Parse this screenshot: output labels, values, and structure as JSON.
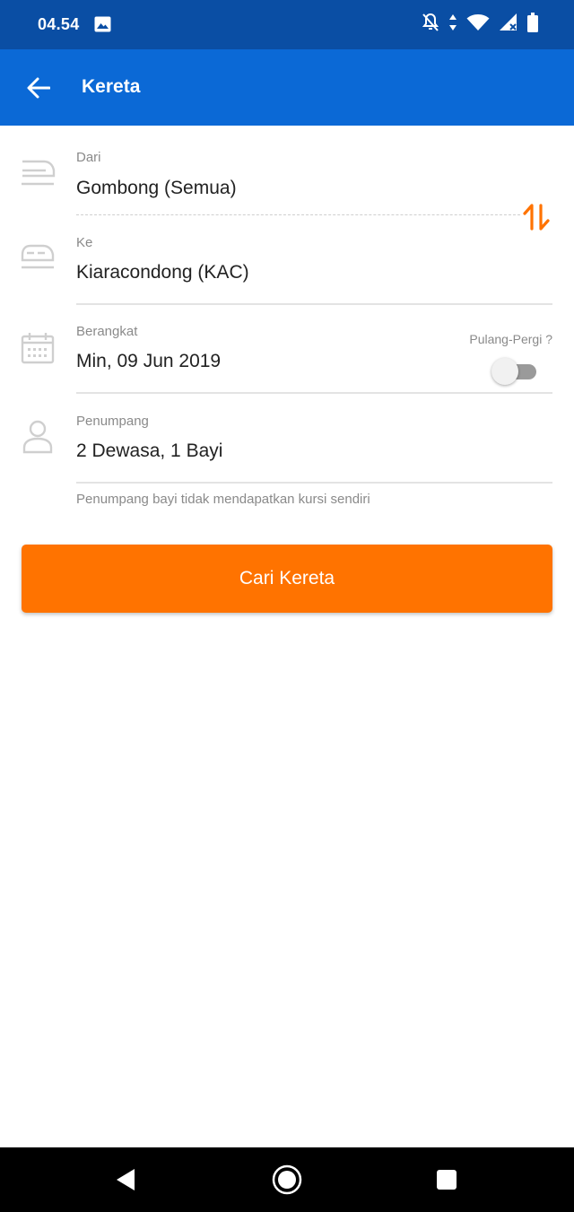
{
  "status_bar": {
    "time": "04.54"
  },
  "app_bar": {
    "title": "Kereta"
  },
  "form": {
    "from": {
      "label": "Dari",
      "value": "Gombong (Semua)"
    },
    "to": {
      "label": "Ke",
      "value": "Kiaracondong (KAC)"
    },
    "depart": {
      "label": "Berangkat",
      "value": "Min, 09 Jun 2019"
    },
    "round_trip": {
      "label": "Pulang-Pergi ?",
      "enabled": false
    },
    "passengers": {
      "label": "Penumpang",
      "value": "2 Dewasa, 1 Bayi"
    },
    "note": "Penumpang bayi tidak mendapatkan kursi sendiri"
  },
  "search_button": {
    "label": "Cari Kereta"
  },
  "colors": {
    "status_bar": "#0a4ea4",
    "app_bar": "#0b69d6",
    "accent": "#ff7300",
    "icon_gray": "#cfcfcf"
  },
  "icons": [
    "back-arrow-icon",
    "train-icon",
    "train-icon",
    "swap-icon",
    "calendar-icon",
    "person-icon",
    "toggle-switch",
    "nav-back-icon",
    "nav-home-icon",
    "nav-recents-icon"
  ]
}
